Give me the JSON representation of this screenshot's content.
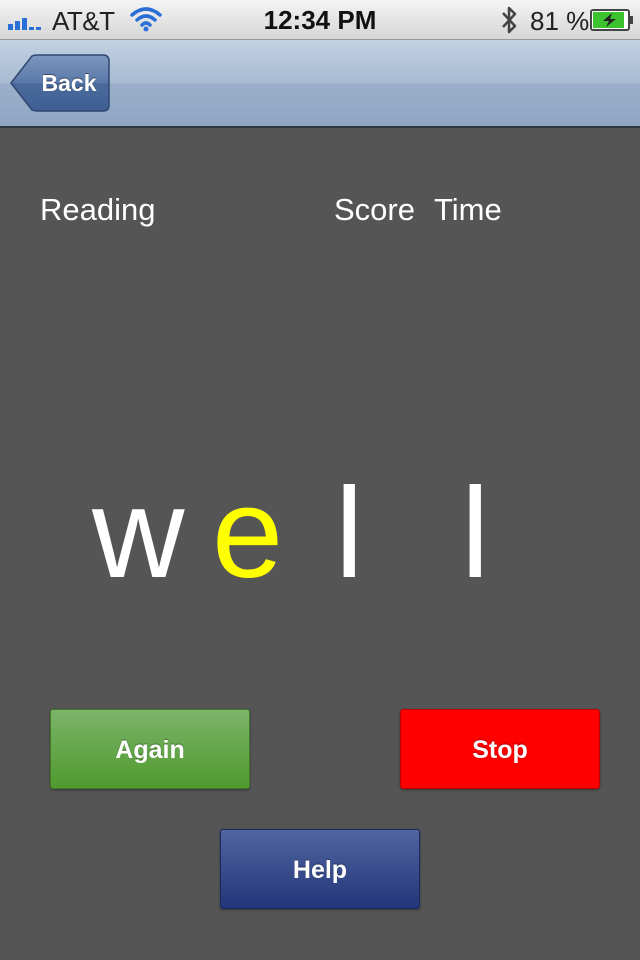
{
  "status_bar": {
    "carrier": "AT&T",
    "time": "12:34 PM",
    "battery_percent": "81 %",
    "icons": [
      "signal-bars-icon",
      "wifi-icon",
      "bluetooth-icon",
      "battery-charging-icon"
    ]
  },
  "nav": {
    "back_label": "Back"
  },
  "header": {
    "reading": "Reading",
    "score": "Score",
    "time": "Time"
  },
  "word": {
    "letters": [
      "w",
      "e",
      "l",
      "l"
    ],
    "highlight_color": "#ffff00",
    "default_color": "#ffffff"
  },
  "buttons": {
    "again": "Again",
    "stop": "Stop",
    "help": "Help"
  },
  "colors": {
    "background": "#555555",
    "again": "#5aa23a",
    "stop": "#ff0000",
    "help": "#2f4384"
  }
}
